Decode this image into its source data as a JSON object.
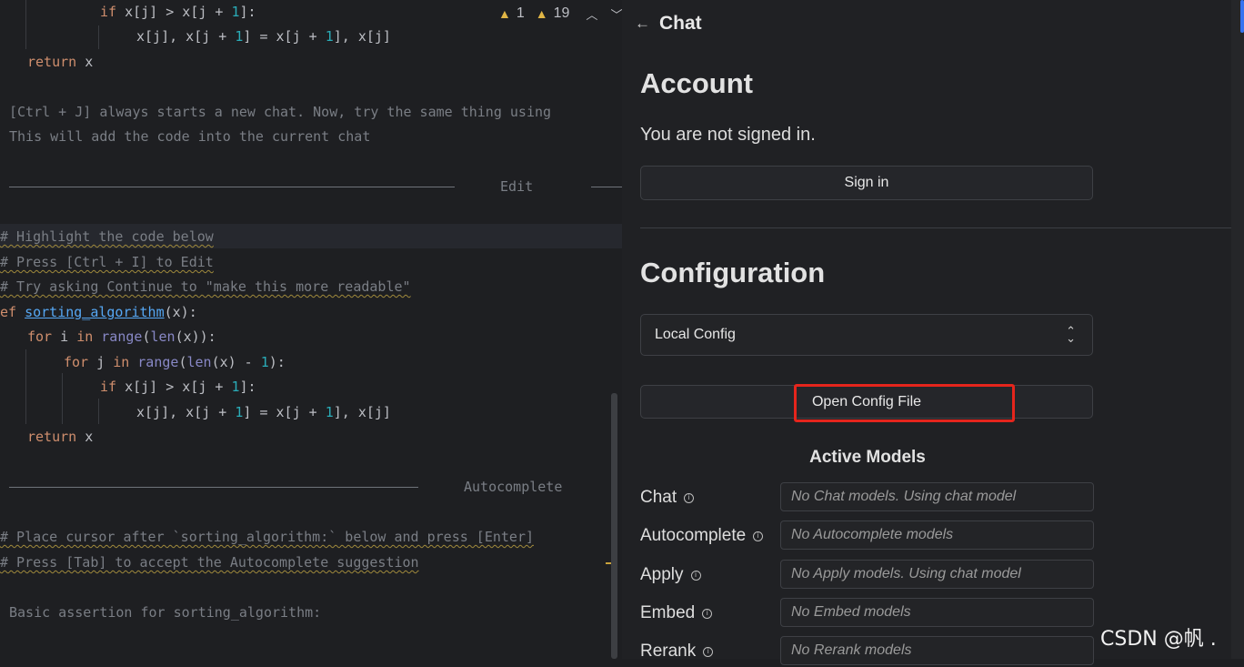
{
  "editor": {
    "inspection": {
      "warnings_a": "1",
      "warnings_b": "19"
    },
    "top_code": {
      "line1": [
        "if",
        " x[j] > x[j + ",
        "1",
        "]:"
      ],
      "line2": [
        "x[j], x[j + ",
        "1",
        "] = x[j + ",
        "1",
        "], x[j]"
      ],
      "line3": [
        "return",
        " x"
      ]
    },
    "chat_hint_1": "[Ctrl + J] always starts a new chat. Now, try the same thing using",
    "chat_hint_2": "This will add the code into the current chat",
    "section_edit": "Edit",
    "comments_edit": [
      "# Highlight the code below",
      "# Press [Ctrl + I] to Edit",
      "# Try asking Continue to \"make this more readable\""
    ],
    "code": {
      "def_kw": "ef",
      "fn_name": "sorting_algorithm",
      "fn_tail": "(x):",
      "for1": [
        "for",
        " i ",
        "in",
        " ",
        "range",
        "(",
        "len",
        "(x)):"
      ],
      "for2": [
        "for",
        " j ",
        "in",
        " ",
        "range",
        "(",
        "len",
        "(x) - ",
        "1",
        "):"
      ],
      "if": [
        "if",
        " x[j] > x[j + ",
        "1",
        "]:"
      ],
      "swap": [
        "x[j], x[j + ",
        "1",
        "] = x[j + ",
        "1",
        "], x[j]"
      ],
      "ret": [
        "return",
        " x"
      ]
    },
    "section_autocomplete": "Autocomplete",
    "comments_autocomplete": [
      "# Place cursor after `sorting_algorithm:` below and press [Enter]",
      "# Press [Tab] to accept the Autocomplete suggestion"
    ],
    "assertion_text": "Basic assertion for sorting_algorithm:"
  },
  "panel": {
    "back_icon": "arrow-left-icon",
    "title": "Chat",
    "account_heading": "Account",
    "not_signed_in": "You are not signed in.",
    "sign_in_button": "Sign in",
    "configuration_heading": "Configuration",
    "config_select_value": "Local Config",
    "open_config_button": "Open Config File",
    "active_models_heading": "Active Models",
    "models": [
      {
        "label": "Chat",
        "value": "No Chat models. Using chat model"
      },
      {
        "label": "Autocomplete",
        "value": "No Autocomplete models"
      },
      {
        "label": "Apply",
        "value": "No Apply models. Using chat model"
      },
      {
        "label": "Embed",
        "value": "No Embed models"
      },
      {
        "label": "Rerank",
        "value": "No Rerank models"
      }
    ],
    "highlight_color": "#e5251c"
  },
  "watermark": "CSDN @帆 ."
}
